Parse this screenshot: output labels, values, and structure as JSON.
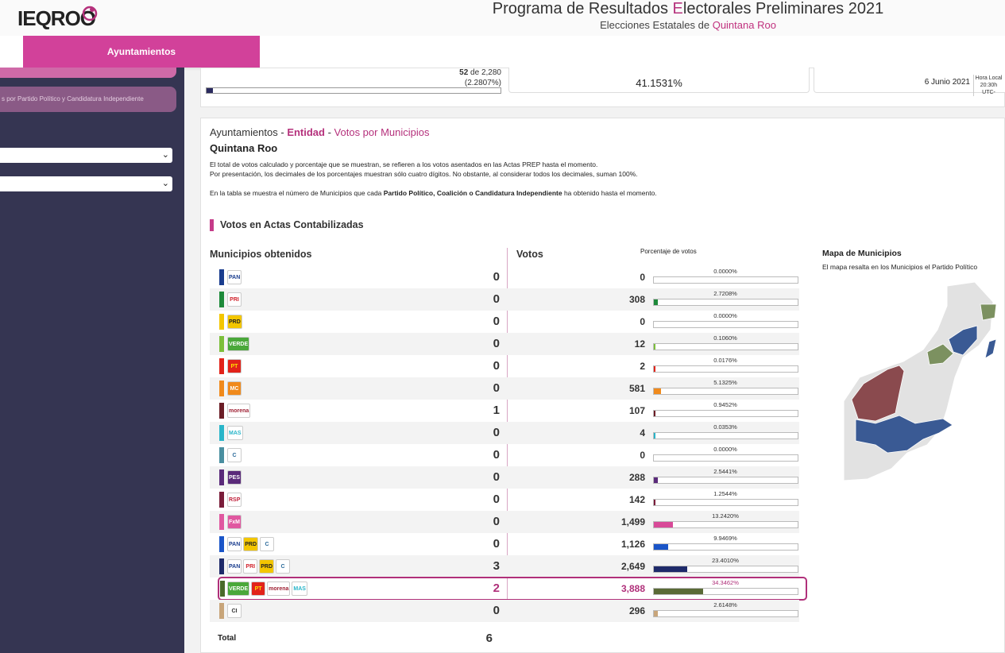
{
  "header": {
    "logo_text": "IEQROO",
    "title_pre": "Programa de Resultados ",
    "title_hl": "E",
    "title_post": "lectorales Preliminares 2021",
    "subtitle_pre": "Elecciones Estatales de ",
    "subtitle_hl": "Quintana Roo"
  },
  "nav": {
    "active_tab": "Ayuntamientos"
  },
  "sidebar": {
    "filter_label": "s por Partido Político y Candidatura Independiente",
    "select1_value": "",
    "select2_value": ""
  },
  "stats": {
    "actas_count": "52",
    "actas_of": " de 2,280",
    "actas_pct": "(2.2807%)",
    "actas_progress": 0.022807,
    "participacion": "41.1531%",
    "date": "6 Junio 2021",
    "hora_label": "Hora Local",
    "hora_value": "20:30h UTC-"
  },
  "main": {
    "crumb_a": "Ayuntamientos - ",
    "crumb_b": "Entidad",
    "crumb_c": " - ",
    "crumb_d": "Votos por Municipios",
    "state": "Quintana Roo",
    "note1": "El total de votos calculado y porcentaje que se muestran, se refieren a los votos asentados en las Actas PREP hasta el momento.",
    "note2": "Por presentación, los decimales de los porcentajes muestran sólo cuatro dígitos. No obstante, al considerar todos los decimales, suman 100%.",
    "note3_a": "En la tabla se muestra el número de Municipios que cada ",
    "note3_b": "Partido Político, Coalición o Candidatura Independiente",
    "note3_c": " ha obtenido hasta el momento.",
    "section_title": "Votos en Actas Contabilizadas",
    "col_municipios": "Municipios obtenidos",
    "col_votos": "Votos",
    "col_pct": "Porcentaje de votos",
    "total_label": "Total",
    "total_value": "6"
  },
  "rows": [
    {
      "stripe": "#1a3d8e",
      "logos": [
        {
          "t": "PAN",
          "bg": "#ffffff",
          "fg": "#1a3d8e"
        }
      ],
      "mun": "0",
      "votes": "0",
      "pct": "0.0000%",
      "frac": 0.0,
      "bar": "#1a3d8e"
    },
    {
      "stripe": "#1e8a3a",
      "logos": [
        {
          "t": "PRI",
          "bg": "#ffffff",
          "fg": "#d0202a"
        }
      ],
      "mun": "0",
      "votes": "308",
      "pct": "2.7208%",
      "frac": 0.027208,
      "bar": "#1e8a3a"
    },
    {
      "stripe": "#f3c600",
      "logos": [
        {
          "t": "PRD",
          "bg": "#f3c600",
          "fg": "#222"
        }
      ],
      "mun": "0",
      "votes": "0",
      "pct": "0.0000%",
      "frac": 0.0,
      "bar": "#f3c600"
    },
    {
      "stripe": "#7cbf3a",
      "logos": [
        {
          "t": "VERDE",
          "bg": "#4aa83a",
          "fg": "#fff"
        }
      ],
      "mun": "0",
      "votes": "12",
      "pct": "0.1060%",
      "frac": 0.00106,
      "bar": "#7cbf3a"
    },
    {
      "stripe": "#e2231a",
      "logos": [
        {
          "t": "PT",
          "bg": "#e2231a",
          "fg": "#ffde00"
        }
      ],
      "mun": "0",
      "votes": "2",
      "pct": "0.0176%",
      "frac": 0.000176,
      "bar": "#e2231a"
    },
    {
      "stripe": "#f08a1c",
      "logos": [
        {
          "t": "MC",
          "bg": "#f08a1c",
          "fg": "#fff"
        }
      ],
      "mun": "0",
      "votes": "581",
      "pct": "5.1325%",
      "frac": 0.051325,
      "bar": "#f08a1c"
    },
    {
      "stripe": "#6b1d26",
      "logos": [
        {
          "t": "morena",
          "bg": "#ffffff",
          "fg": "#9e2033"
        }
      ],
      "mun": "1",
      "votes": "107",
      "pct": "0.9452%",
      "frac": 0.009452,
      "bar": "#6b1d26"
    },
    {
      "stripe": "#29b5c9",
      "logos": [
        {
          "t": "MAS",
          "bg": "#ffffff",
          "fg": "#29b5c9"
        }
      ],
      "mun": "0",
      "votes": "4",
      "pct": "0.0353%",
      "frac": 0.000353,
      "bar": "#29b5c9"
    },
    {
      "stripe": "#4a8fa0",
      "logos": [
        {
          "t": "C",
          "bg": "#ffffff",
          "fg": "#2a6a9a"
        }
      ],
      "mun": "0",
      "votes": "0",
      "pct": "0.0000%",
      "frac": 0.0,
      "bar": "#4a8fa0"
    },
    {
      "stripe": "#5a2a7a",
      "logos": [
        {
          "t": "PES",
          "bg": "#5a2a7a",
          "fg": "#fff"
        }
      ],
      "mun": "0",
      "votes": "288",
      "pct": "2.5441%",
      "frac": 0.025441,
      "bar": "#5a2a7a"
    },
    {
      "stripe": "#7a1d3a",
      "logos": [
        {
          "t": "RSP",
          "bg": "#ffffff",
          "fg": "#c0203a"
        }
      ],
      "mun": "0",
      "votes": "142",
      "pct": "1.2544%",
      "frac": 0.012544,
      "bar": "#7a1d3a"
    },
    {
      "stripe": "#e058a0",
      "logos": [
        {
          "t": "FxM",
          "bg": "#e058a0",
          "fg": "#fff"
        }
      ],
      "mun": "0",
      "votes": "1,499",
      "pct": "13.2420%",
      "frac": 0.13242,
      "bar": "#d84a98"
    },
    {
      "stripe": "#1a55c8",
      "logos": [
        {
          "t": "PAN",
          "bg": "#ffffff",
          "fg": "#1a3d8e"
        },
        {
          "t": "PRD",
          "bg": "#f3c600",
          "fg": "#222"
        },
        {
          "t": "C",
          "bg": "#ffffff",
          "fg": "#2a6a9a"
        }
      ],
      "mun": "0",
      "votes": "1,126",
      "pct": "9.9469%",
      "frac": 0.099469,
      "bar": "#1a55c8"
    },
    {
      "stripe": "#1e2a6a",
      "logos": [
        {
          "t": "PAN",
          "bg": "#ffffff",
          "fg": "#1a3d8e"
        },
        {
          "t": "PRI",
          "bg": "#ffffff",
          "fg": "#d0202a"
        },
        {
          "t": "PRD",
          "bg": "#f3c600",
          "fg": "#222"
        },
        {
          "t": "C",
          "bg": "#ffffff",
          "fg": "#2a6a9a"
        }
      ],
      "mun": "3",
      "votes": "2,649",
      "pct": "23.4010%",
      "frac": 0.23401,
      "bar": "#1e2a6a"
    },
    {
      "stripe": "#4a6a2a",
      "logos": [
        {
          "t": "VERDE",
          "bg": "#4aa83a",
          "fg": "#fff"
        },
        {
          "t": "PT",
          "bg": "#e2231a",
          "fg": "#ffde00"
        },
        {
          "t": "morena",
          "bg": "#ffffff",
          "fg": "#9e2033"
        },
        {
          "t": "MAS",
          "bg": "#ffffff",
          "fg": "#29b5c9"
        }
      ],
      "mun": "2",
      "votes": "3,888",
      "pct": "34.3462%",
      "frac": 0.343462,
      "bar": "#5a6a36",
      "win": true
    },
    {
      "stripe": "#c8a57a",
      "logos": [
        {
          "t": "CI",
          "bg": "#ffffff",
          "fg": "#333"
        }
      ],
      "mun": "0",
      "votes": "296",
      "pct": "2.6148%",
      "frac": 0.026148,
      "bar": "#c8a57a"
    }
  ],
  "map": {
    "title": "Mapa de Municipios",
    "desc": "El mapa resalta en los Municipios el Partido Político",
    "colors": {
      "blue": "#3a5a94",
      "green": "#7c9160",
      "maroon": "#8a4a4e",
      "gray": "#e2e2e2"
    }
  }
}
